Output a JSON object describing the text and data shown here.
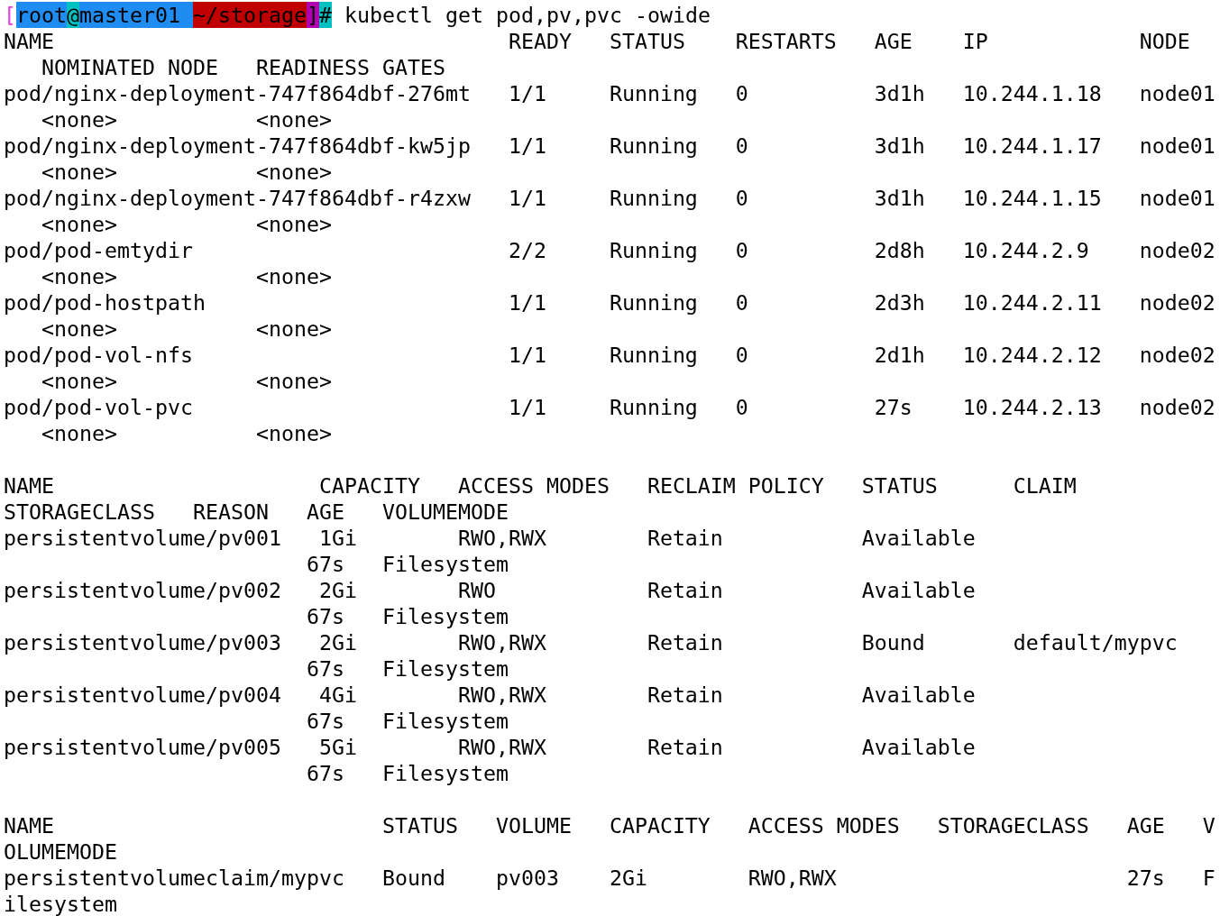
{
  "prompt": {
    "segments": [
      {
        "text": "[",
        "kind": "ink",
        "color": "#e040e0"
      },
      {
        "text": "root",
        "kind": "block",
        "color": "#1e8cf0"
      },
      {
        "text": "@",
        "kind": "block",
        "color": "#00c0c0"
      },
      {
        "text": "master01 ",
        "kind": "block",
        "color": "#1e8cf0"
      },
      {
        "text": "~/storage",
        "kind": "block",
        "color": "#c00000"
      },
      {
        "text": "]",
        "kind": "block",
        "color": "#b000b0"
      },
      {
        "text": "#",
        "kind": "block",
        "color": "#00c0c0"
      }
    ],
    "command": " kubectl get pod,pv,pvc -owide"
  },
  "output_sections": [
    {
      "lines": [
        "NAME                                    READY   STATUS    RESTARTS   AGE    IP            NODE",
        "   NOMINATED NODE   READINESS GATES",
        "pod/nginx-deployment-747f864dbf-276mt   1/1     Running   0          3d1h   10.244.1.18   node01",
        "   <none>           <none>",
        "pod/nginx-deployment-747f864dbf-kw5jp   1/1     Running   0          3d1h   10.244.1.17   node01",
        "   <none>           <none>",
        "pod/nginx-deployment-747f864dbf-r4zxw   1/1     Running   0          3d1h   10.244.1.15   node01",
        "   <none>           <none>",
        "pod/pod-emtydir                         2/2     Running   0          2d8h   10.244.2.9    node02",
        "   <none>           <none>",
        "pod/pod-hostpath                        1/1     Running   0          2d3h   10.244.2.11   node02",
        "   <none>           <none>",
        "pod/pod-vol-nfs                         1/1     Running   0          2d1h   10.244.2.12   node02",
        "   <none>           <none>",
        "pod/pod-vol-pvc                         1/1     Running   0          27s    10.244.2.13   node02",
        "   <none>           <none>"
      ]
    },
    {
      "lines": [
        "NAME                     CAPACITY   ACCESS MODES   RECLAIM POLICY   STATUS      CLAIM",
        "STORAGECLASS   REASON   AGE   VOLUMEMODE",
        "persistentvolume/pv001   1Gi        RWO,RWX        Retain           Available",
        "                        67s   Filesystem",
        "persistentvolume/pv002   2Gi        RWO            Retain           Available",
        "                        67s   Filesystem",
        "persistentvolume/pv003   2Gi        RWO,RWX        Retain           Bound       default/mypvc",
        "                        67s   Filesystem",
        "persistentvolume/pv004   4Gi        RWO,RWX        Retain           Available",
        "                        67s   Filesystem",
        "persistentvolume/pv005   5Gi        RWO,RWX        Retain           Available",
        "                        67s   Filesystem"
      ]
    },
    {
      "lines": [
        "NAME                          STATUS   VOLUME   CAPACITY   ACCESS MODES   STORAGECLASS   AGE   V",
        "OLUMEMODE",
        "persistentvolumeclaim/mypvc   Bound    pv003    2Gi        RWO,RWX                       27s   F",
        "ilesystem"
      ]
    }
  ]
}
